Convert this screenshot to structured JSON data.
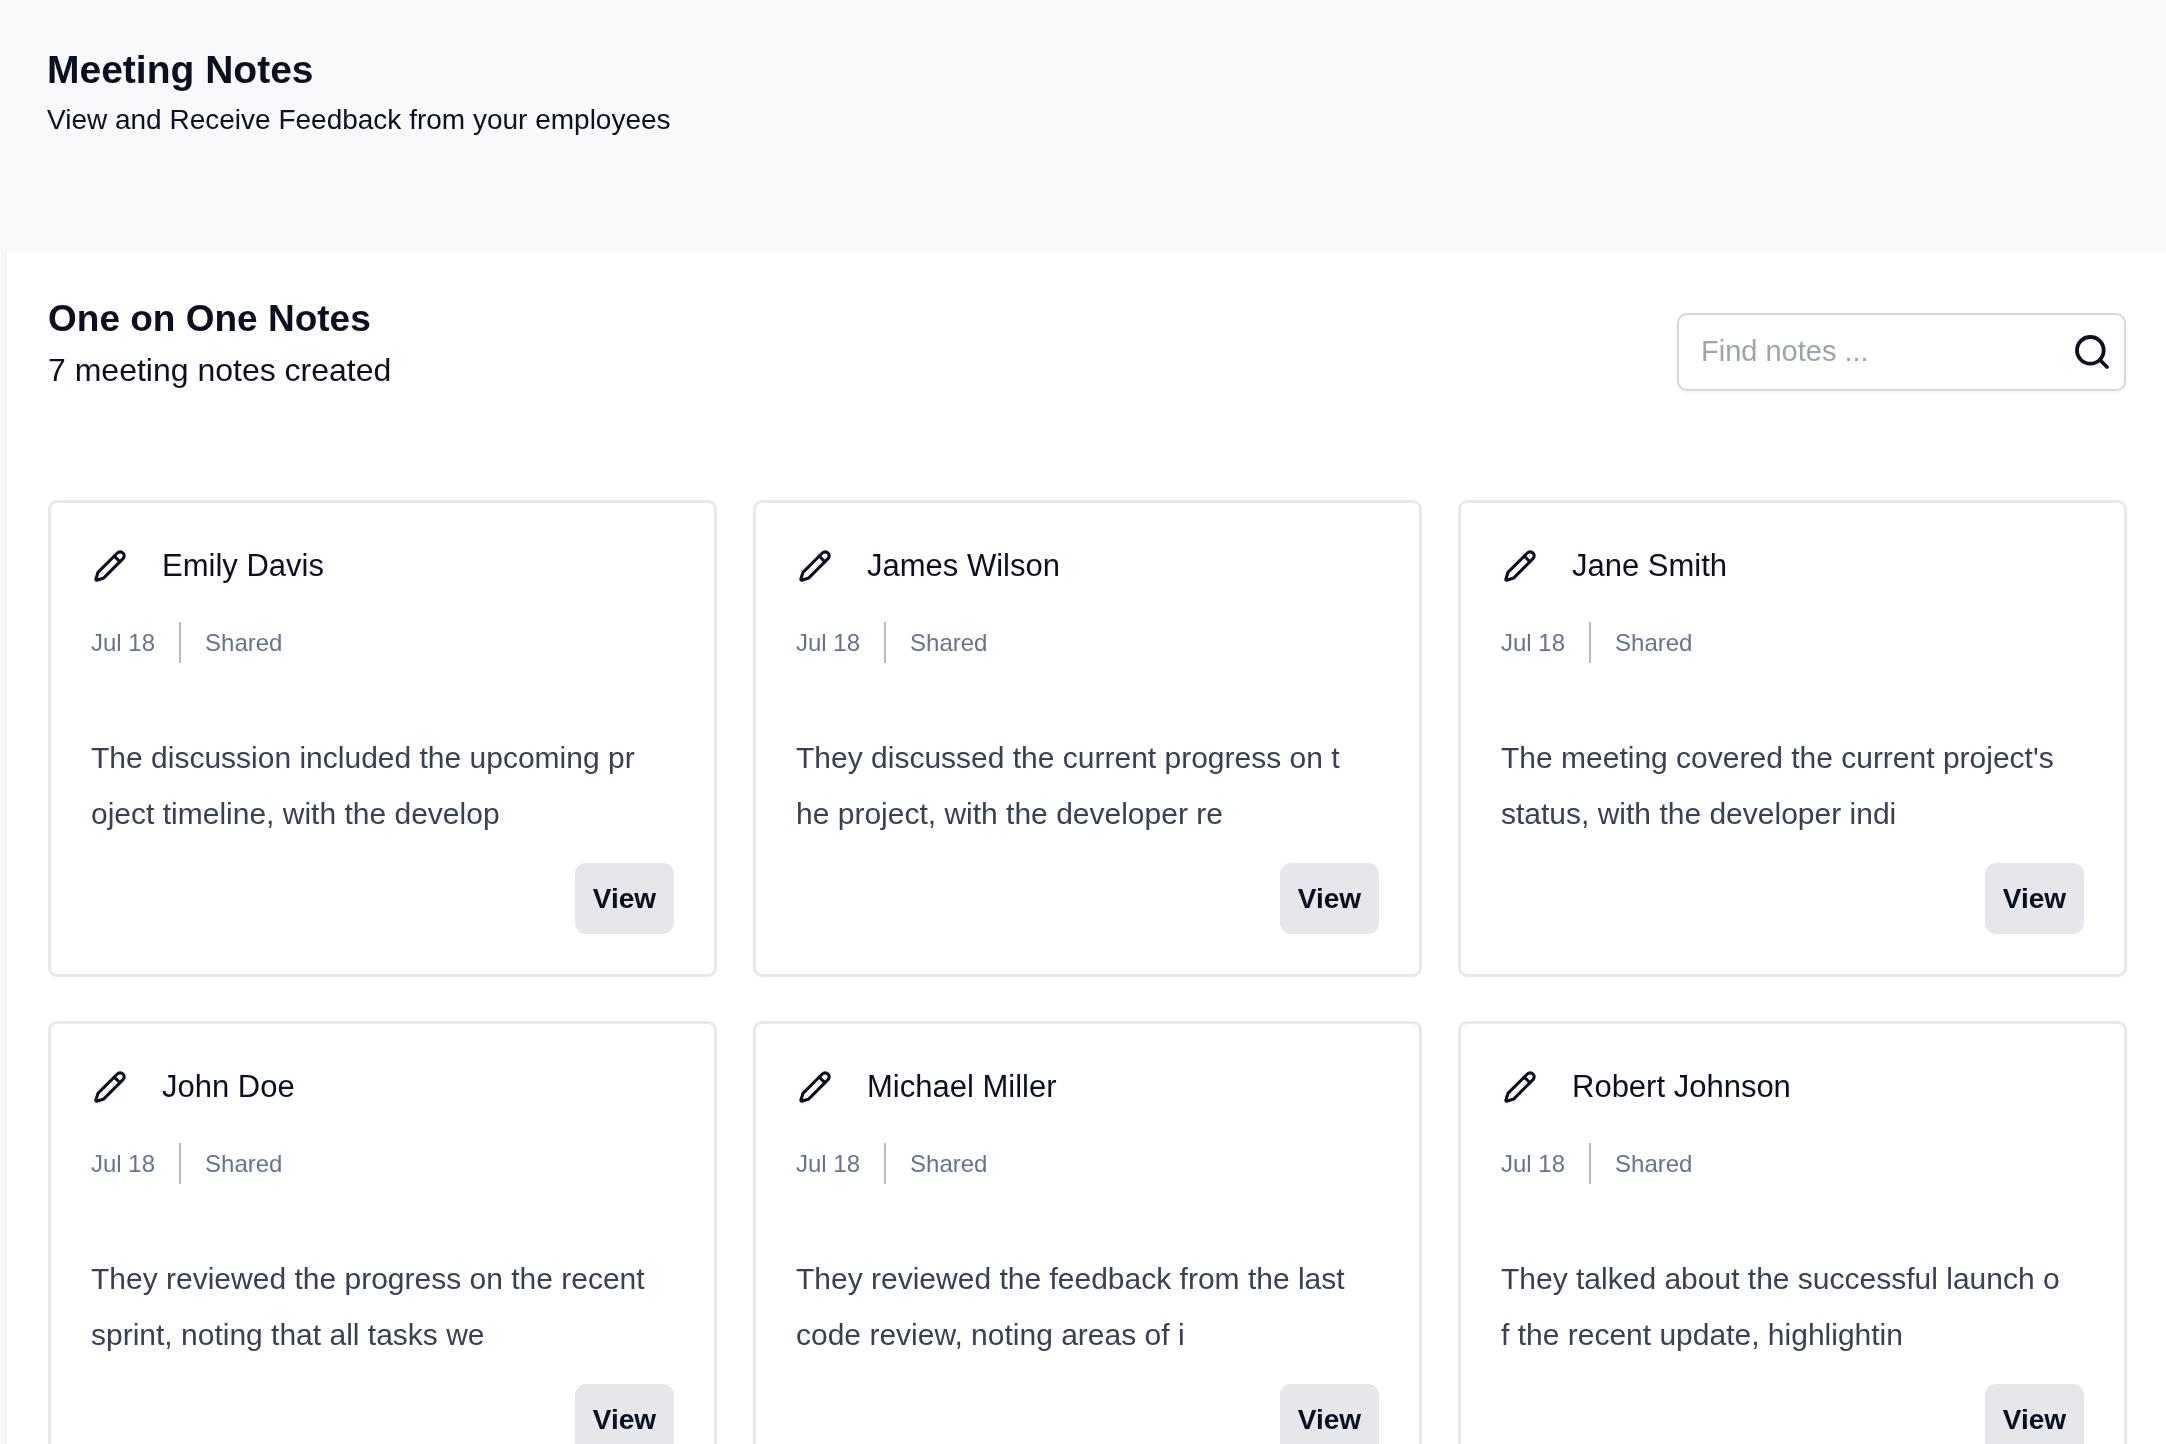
{
  "header": {
    "title": "Meeting Notes",
    "subtitle": "View and Receive Feedback from your employees"
  },
  "section": {
    "title": "One on One Notes",
    "count": "7 meeting notes created"
  },
  "search": {
    "placeholder": "Find notes ..."
  },
  "notes": [
    {
      "name": "Emily Davis",
      "date": "Jul 18",
      "status": "Shared",
      "summary": "The discussion included the upcoming project timeline, with the develop",
      "action": "View"
    },
    {
      "name": "James Wilson",
      "date": "Jul 18",
      "status": "Shared",
      "summary": "They discussed the current progress on the project, with the developer re",
      "action": "View"
    },
    {
      "name": "Jane Smith",
      "date": "Jul 18",
      "status": "Shared",
      "summary": "The meeting covered the current project's status, with the developer indi",
      "action": "View"
    },
    {
      "name": "John Doe",
      "date": "Jul 18",
      "status": "Shared",
      "summary": "They reviewed the progress on the recent sprint, noting that all tasks we",
      "action": "View"
    },
    {
      "name": "Michael Miller",
      "date": "Jul 18",
      "status": "Shared",
      "summary": "They reviewed the feedback from the last code review, noting areas of i",
      "action": "View"
    },
    {
      "name": "Robert Johnson",
      "date": "Jul 18",
      "status": "Shared",
      "summary": "They talked about the successful launch of the recent update, highlightin",
      "action": "View"
    }
  ]
}
